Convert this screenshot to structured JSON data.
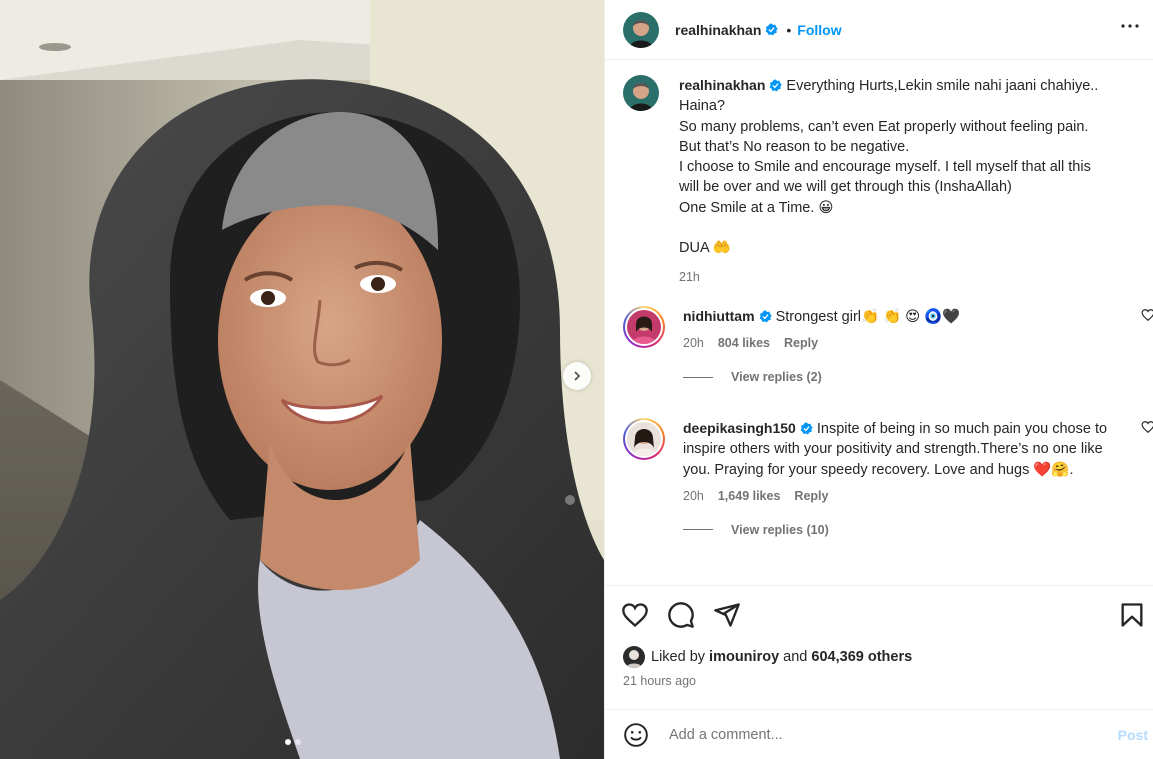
{
  "post": {
    "author": "realhinakhan",
    "follow_label": "Follow",
    "bullet": "•",
    "carousel": {
      "current": 1,
      "total": 2
    }
  },
  "caption": {
    "author": "realhinakhan",
    "lines": [
      "Everything Hurts,Lekin smile nahi jaani chahiye..",
      "Haina?",
      "So many problems, can’t even Eat properly without feeling pain.",
      "But that’s No reason to be negative.",
      "I choose to Smile and encourage myself. I tell myself that all this",
      "will be over and we will get through this (InshaAllah)",
      "One Smile at a Time. 😀",
      "",
      "DUA 🤲"
    ],
    "time": "21h"
  },
  "comments": [
    {
      "author": "nidhiuttam",
      "text": "Strongest girl👏 👏 😍 🧿🖤",
      "time": "20h",
      "likes": "804 likes",
      "reply_label": "Reply",
      "view_replies": "View replies (2)"
    },
    {
      "author": "deepikasingh150",
      "text": "Inspite of being in so much pain you chose to inspire others with your positivity and strength.There’s no one like you. Praying for your speedy recovery. Love and hugs ❤️🤗.",
      "time": "20h",
      "likes": "1,649 likes",
      "reply_label": "Reply",
      "view_replies": "View replies (10)"
    }
  ],
  "likes": {
    "prefix": "Liked by",
    "user": "imouniroy",
    "and": "and",
    "others": "604,369 others"
  },
  "posted_ago": "21 hours ago",
  "add_comment": {
    "placeholder": "Add a comment...",
    "post_label": "Post"
  },
  "colors": {
    "accent": "#0095f6",
    "verified": "#0095f6",
    "muted": "#737373",
    "post_disabled": "#b3dbff"
  },
  "icons": [
    "verified-badge-icon",
    "more-options-icon",
    "heart-icon",
    "comment-icon",
    "share-icon",
    "bookmark-icon",
    "emoji-icon",
    "chevron-right-icon"
  ]
}
